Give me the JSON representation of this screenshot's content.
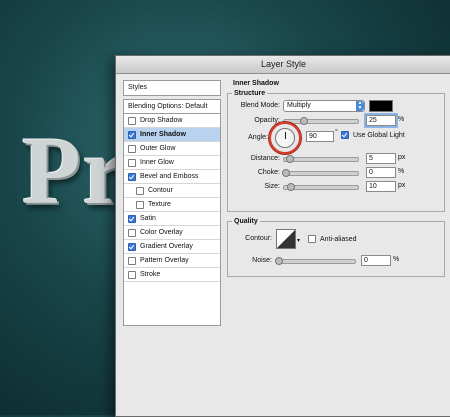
{
  "background": {
    "text": "Pr"
  },
  "dialog": {
    "title": "Layer Style"
  },
  "sidebar": {
    "header": "Styles",
    "items": [
      {
        "label": "Blending Options: Default",
        "checkbox": false
      },
      {
        "label": "Drop Shadow",
        "checkbox": true,
        "checked": false
      },
      {
        "label": "Inner Shadow",
        "checkbox": true,
        "checked": true,
        "selected": true
      },
      {
        "label": "Outer Glow",
        "checkbox": true,
        "checked": false
      },
      {
        "label": "Inner Glow",
        "checkbox": true,
        "checked": false
      },
      {
        "label": "Bevel and Emboss",
        "checkbox": true,
        "checked": true
      },
      {
        "label": "Contour",
        "checkbox": true,
        "checked": false,
        "sub": true
      },
      {
        "label": "Texture",
        "checkbox": true,
        "checked": false,
        "sub": true
      },
      {
        "label": "Satin",
        "checkbox": true,
        "checked": true
      },
      {
        "label": "Color Overlay",
        "checkbox": true,
        "checked": false
      },
      {
        "label": "Gradient Overlay",
        "checkbox": true,
        "checked": true
      },
      {
        "label": "Pattern Overlay",
        "checkbox": true,
        "checked": false
      },
      {
        "label": "Stroke",
        "checkbox": true,
        "checked": false
      }
    ]
  },
  "panel": {
    "title": "Inner Shadow",
    "structure": {
      "legend": "Structure",
      "blend_mode_label": "Blend Mode:",
      "blend_mode_value": "Multiply",
      "color": "#000000",
      "opacity_label": "Opacity:",
      "opacity_value": "25",
      "opacity_fraction": 0.25,
      "percent": "%",
      "angle_label": "Angle:",
      "angle_value": "90",
      "degree": "°",
      "global_light_label": "Use Global Light",
      "global_light_checked": true,
      "distance_label": "Distance:",
      "distance_value": "5",
      "px": "px",
      "choke_label": "Choke:",
      "choke_value": "0",
      "size_label": "Size:",
      "size_value": "10"
    },
    "quality": {
      "legend": "Quality",
      "contour_label": "Contour:",
      "anti_aliased_label": "Anti-aliased",
      "anti_aliased_checked": false,
      "noise_label": "Noise:",
      "noise_value": "0",
      "percent": "%"
    }
  },
  "accent_color": "#3b78d8",
  "highlight_color": "#d23b2c"
}
